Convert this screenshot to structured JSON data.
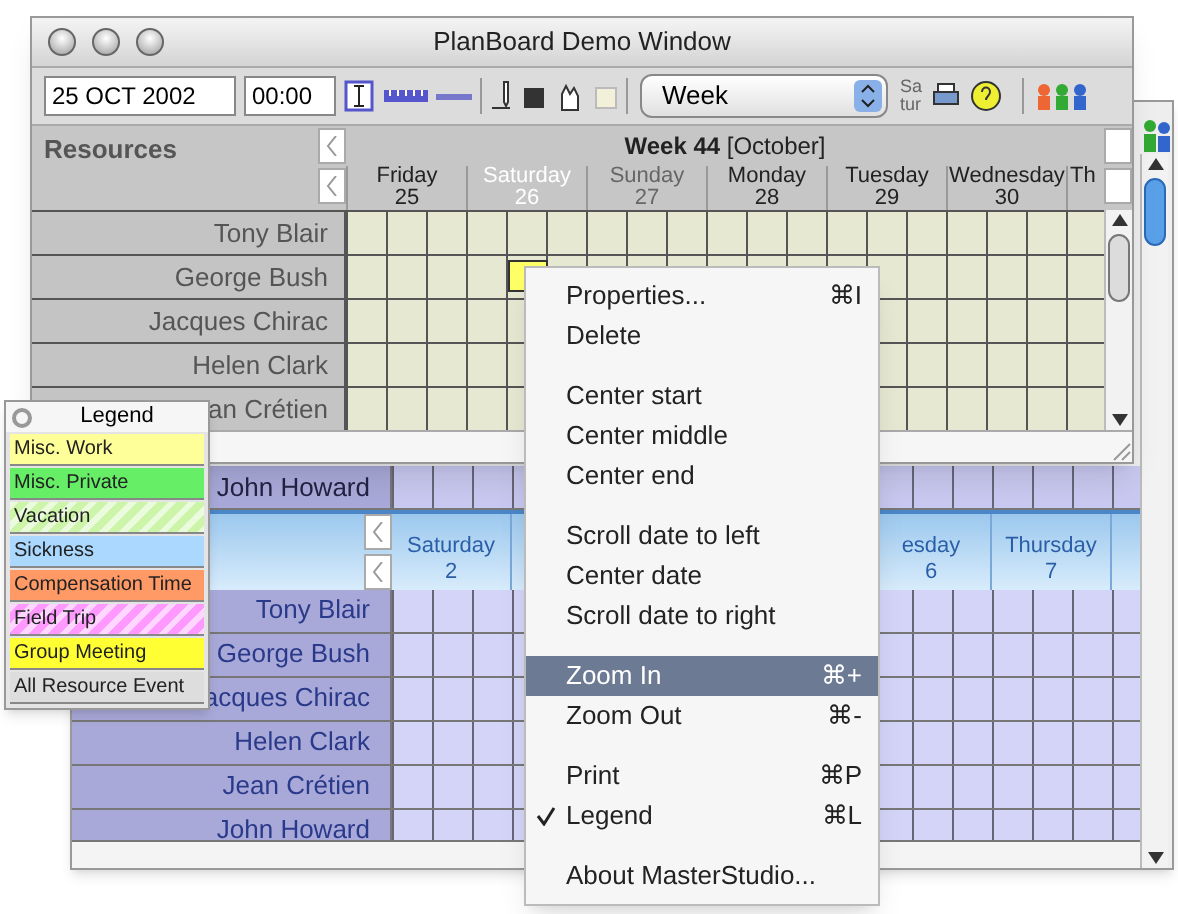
{
  "back_window": {
    "top_row": {
      "name": "John Howard"
    },
    "days": [
      {
        "day": "Saturday",
        "date": "2"
      },
      {
        "day": "esday",
        "date": "6"
      },
      {
        "day": "Thursday",
        "date": "7"
      }
    ],
    "resources": [
      {
        "name": "Tony Blair"
      },
      {
        "name": "George Bush"
      },
      {
        "name": "acques Chirac"
      },
      {
        "name": "Helen Clark"
      },
      {
        "name": "Jean Crétien"
      },
      {
        "name": "John Howard"
      }
    ]
  },
  "window": {
    "title": "PlanBoard Demo Window",
    "toolbar": {
      "date": "25 OCT 2002",
      "time": "00:00",
      "view": "Week",
      "day_short_1": "Sa",
      "day_short_2": "tur"
    },
    "resources_header": "Resources",
    "week": "Week 44",
    "month": "[October]",
    "days": [
      {
        "day": "Friday",
        "date": "25",
        "kind": "normal"
      },
      {
        "day": "Saturday",
        "date": "26",
        "kind": "highlighted"
      },
      {
        "day": "Sunday",
        "date": "27",
        "kind": "dimmed"
      },
      {
        "day": "Monday",
        "date": "28",
        "kind": "normal"
      },
      {
        "day": "Tuesday",
        "date": "29",
        "kind": "normal"
      },
      {
        "day": "Wednesday",
        "date": "30",
        "kind": "normal"
      },
      {
        "day": "Th",
        "kind": "normal"
      }
    ],
    "resources": [
      {
        "name": "Tony Blair"
      },
      {
        "name": "George Bush"
      },
      {
        "name": "Jacques Chirac"
      },
      {
        "name": "Helen Clark"
      },
      {
        "name": "an Crétien"
      }
    ]
  },
  "legend": {
    "title": "Legend",
    "items": [
      {
        "label": "Misc. Work",
        "color": "#ffff99",
        "kind": "plain"
      },
      {
        "label": "Misc. Private",
        "color": "#66ee66",
        "kind": "plain"
      },
      {
        "label": "Vacation",
        "color": "#ccf5aa",
        "kind": "striped"
      },
      {
        "label": "Sickness",
        "color": "#aad8ff",
        "kind": "plain"
      },
      {
        "label": "Compensation Time",
        "color": "#ff9966",
        "kind": "plain"
      },
      {
        "label": "Field Trip",
        "color": "#ff99ff",
        "kind": "striped"
      },
      {
        "label": "Group Meeting",
        "color": "#ffff33",
        "kind": "plain"
      },
      {
        "label": "All Resource Event",
        "color": "#dddddd",
        "kind": "plain"
      }
    ]
  },
  "menu": {
    "groups": [
      {
        "items": [
          {
            "label": "Properties...",
            "shortcut": "⌘I",
            "checked": false,
            "selected": false
          },
          {
            "label": "Delete",
            "checked": false,
            "selected": false
          }
        ]
      },
      {
        "items": [
          {
            "label": "Center start",
            "checked": false,
            "selected": false
          },
          {
            "label": "Center middle",
            "checked": false,
            "selected": false
          },
          {
            "label": "Center end",
            "checked": false,
            "selected": false
          }
        ]
      },
      {
        "items": [
          {
            "label": "Scroll date to left",
            "checked": false,
            "selected": false
          },
          {
            "label": "Center date",
            "checked": false,
            "selected": false
          },
          {
            "label": "Scroll date to right",
            "checked": false,
            "selected": false
          }
        ]
      },
      {
        "items": [
          {
            "label": "Zoom In",
            "shortcut": "⌘+",
            "checked": false,
            "selected": true
          },
          {
            "label": "Zoom Out",
            "shortcut": "⌘-",
            "checked": false,
            "selected": false
          }
        ]
      },
      {
        "items": [
          {
            "label": "Print",
            "shortcut": "⌘P",
            "checked": false,
            "selected": false
          },
          {
            "label": "Legend",
            "shortcut": "⌘L",
            "checked": true,
            "selected": false
          }
        ]
      },
      {
        "items": [
          {
            "label": "About MasterStudio...",
            "checked": false,
            "selected": false
          }
        ]
      }
    ]
  }
}
